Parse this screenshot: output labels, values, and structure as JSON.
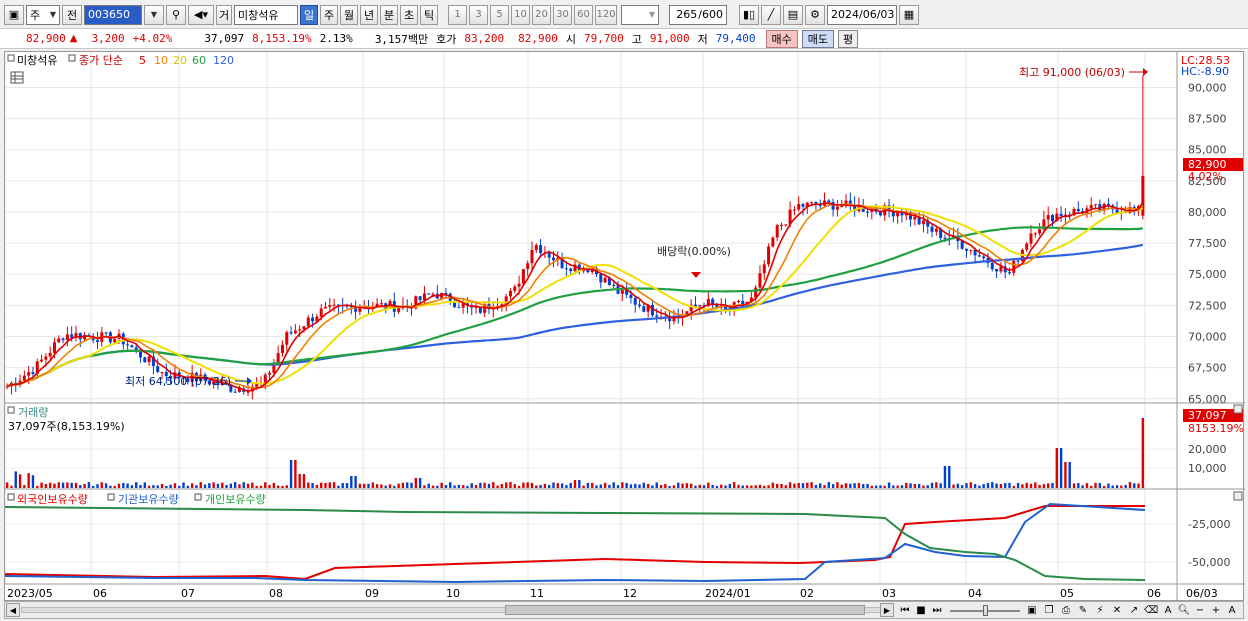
{
  "toolbar": {
    "market": "주",
    "prev": "전",
    "code": "003650",
    "type": "거",
    "name": "미창석유",
    "periods": [
      "일",
      "주",
      "월",
      "년",
      "분",
      "초",
      "틱"
    ],
    "active_period": "일",
    "intervals": [
      "1",
      "3",
      "5",
      "10",
      "20",
      "30",
      "60",
      "120"
    ],
    "count": "265",
    "total": "/600",
    "date": "2024/06/03"
  },
  "quote": {
    "price": "82,900",
    "change": "3,200",
    "rate": "+4.02%",
    "volume": "37,097",
    "vol_ratio": "8,153.19%",
    "turnover": "2.13%",
    "amount": "3,157백만",
    "hoga_label": "호가",
    "ask": "83,200",
    "bid": "82,900",
    "open_label": "시",
    "open": "79,700",
    "high_label": "고",
    "high": "91,000",
    "low_label": "저",
    "low": "79,400",
    "buy": "매수",
    "sell": "매도",
    "extra": "평"
  },
  "price_panel": {
    "legend_name": "미창석유",
    "legend_close": "종가 단순",
    "ma_labels": [
      "5",
      "10",
      "20",
      "60",
      "120"
    ],
    "lc": "LC:28.53",
    "hc": "HC:-8.90",
    "high_note": "최고 91,000 (06/03)",
    "low_note": "최저 64,500 (07/26)",
    "dividend_note": "배당락(0.00%)",
    "last_price_tag": "82,900",
    "last_rate_tag": "4.02%",
    "y_ticks": [
      "90,000",
      "87,500",
      "85,000",
      "82,500",
      "80,000",
      "77,500",
      "75,000",
      "72,500",
      "70,000",
      "67,500",
      "65,000"
    ]
  },
  "volume_panel": {
    "title": "거래량",
    "subtitle": "37,097주(8,153.19%)",
    "tag_value": "37,097",
    "tag_rate": "8153.19%",
    "y_ticks": [
      "20,000",
      "10,000"
    ]
  },
  "holdings_panel": {
    "series": [
      "외국인보유수량",
      "기관보유수량",
      "개인보유수량"
    ],
    "y_ticks": [
      "-25,000",
      "-50,000"
    ]
  },
  "x_axis": {
    "labels": [
      "2023/05",
      "06",
      "07",
      "08",
      "09",
      "10",
      "11",
      "12",
      "2024/01",
      "02",
      "03",
      "04",
      "05",
      "06"
    ],
    "current": "06/03"
  },
  "colors": {
    "up": "#e00000",
    "down": "#0040d0",
    "ma5": "#e00000",
    "ma10": "#f08000",
    "ma20": "#f0e000",
    "ma60": "#20a040",
    "ma120": "#3060e0"
  }
}
